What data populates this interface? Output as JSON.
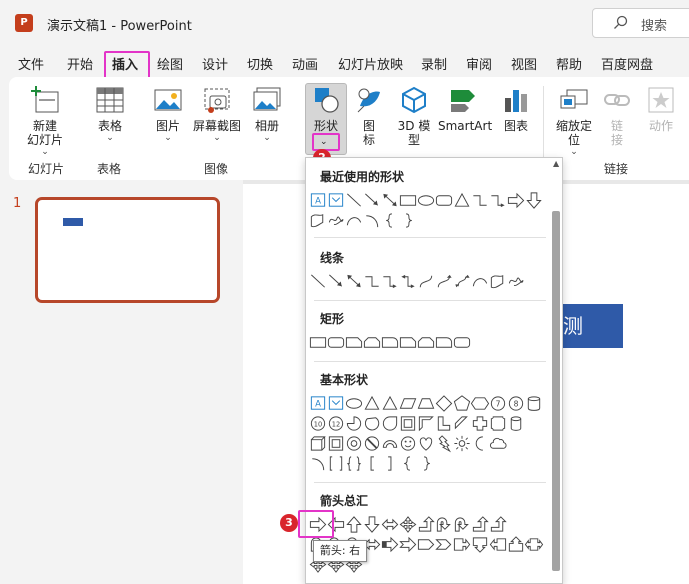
{
  "app": {
    "logo_letter": "P",
    "title": "演示文稿1  -  PowerPoint",
    "search_placeholder": "搜索"
  },
  "tabs": [
    {
      "label": "文件"
    },
    {
      "label": "开始"
    },
    {
      "label": "插入"
    },
    {
      "label": "绘图"
    },
    {
      "label": "设计"
    },
    {
      "label": "切换"
    },
    {
      "label": "动画"
    },
    {
      "label": "幻灯片放映"
    },
    {
      "label": "录制"
    },
    {
      "label": "审阅"
    },
    {
      "label": "视图"
    },
    {
      "label": "帮助"
    },
    {
      "label": "百度网盘"
    }
  ],
  "active_tab": "插入",
  "ribbon": {
    "new_slide": [
      "新建",
      "幻灯片"
    ],
    "table": "表格",
    "picture": "图片",
    "screenshot": "屏幕截图",
    "album": "相册",
    "shapes": "形状",
    "icons": [
      "图",
      "标"
    ],
    "model3d": [
      "3D 模",
      "型"
    ],
    "smartart": "SmartArt",
    "chart": "图表",
    "zoom": [
      "缩放定",
      "位"
    ],
    "link": [
      "链",
      "接"
    ],
    "action": "动作",
    "chevron": "⌄",
    "groups": {
      "slides": "幻灯片",
      "tables": "表格",
      "images": "图像",
      "links": "链接"
    }
  },
  "badges": [
    "1",
    "2",
    "3"
  ],
  "slide_panel": {
    "number": "1",
    "slide_text": "测"
  },
  "dropdown": {
    "sections": [
      "最近使用的形状",
      "线条",
      "矩形",
      "基本形状",
      "箭头总汇"
    ]
  },
  "tooltip": "箭头: 右",
  "colors": {
    "accent": "#c43e1c",
    "highlight": "#e334c8",
    "badge": "#d9252c",
    "shape_blue": "#2f5aa8"
  }
}
